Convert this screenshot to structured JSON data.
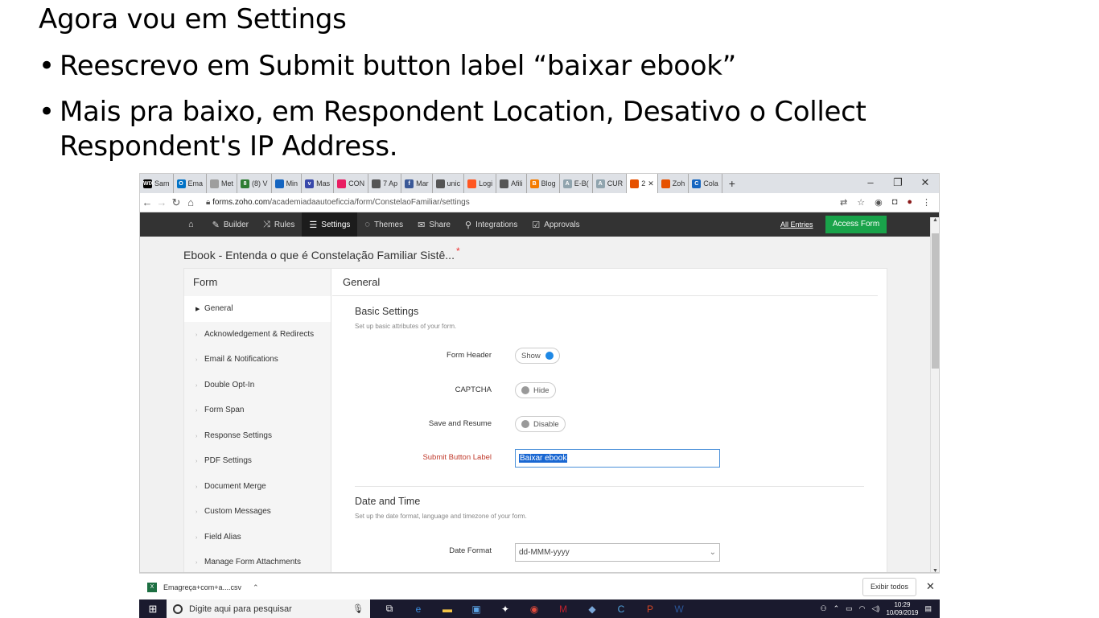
{
  "slide": {
    "title": "Agora vou em Settings",
    "bullets": [
      "Reescrevo em Submit button label “baixar ebook”",
      "Mais pra baixo, em Respondent Location, Desativo o Collect",
      "Respondent's IP Address."
    ],
    "bullet_symbol": "•"
  },
  "browser": {
    "tabs": [
      {
        "label": "Sam",
        "icon": "wix-icon",
        "color": "#000000",
        "glyph": "WIX"
      },
      {
        "label": "Ema",
        "icon": "outlook-icon",
        "color": "#0072c6",
        "glyph": "O"
      },
      {
        "label": "Met",
        "icon": "page-icon",
        "color": "#9e9e9e",
        "glyph": ""
      },
      {
        "label": "(8) V",
        "icon": "green-circle-icon",
        "color": "#2e7d32",
        "glyph": "8"
      },
      {
        "label": "Min",
        "icon": "shield-icon",
        "color": "#1565c0",
        "glyph": ""
      },
      {
        "label": "Mas",
        "icon": "mas-icon",
        "color": "#3949ab",
        "glyph": "v"
      },
      {
        "label": "CON",
        "icon": "circle-icon",
        "color": "#e91e63",
        "glyph": ""
      },
      {
        "label": "7 Ap",
        "icon": "globe-icon",
        "color": "#555555",
        "glyph": ""
      },
      {
        "label": "Mar",
        "icon": "facebook-icon",
        "color": "#3b5998",
        "glyph": "f"
      },
      {
        "label": "unic",
        "icon": "globe-icon",
        "color": "#555555",
        "glyph": ""
      },
      {
        "label": "Logi",
        "icon": "flame-icon",
        "color": "#ff5722",
        "glyph": ""
      },
      {
        "label": "Afili",
        "icon": "globe-icon",
        "color": "#555555",
        "glyph": ""
      },
      {
        "label": "Blog",
        "icon": "blogger-icon",
        "color": "#f57c00",
        "glyph": "B"
      },
      {
        "label": "E-B(",
        "icon": "doc-icon",
        "color": "#90a4ae",
        "glyph": "A"
      },
      {
        "label": "CUR",
        "icon": "doc-icon",
        "color": "#90a4ae",
        "glyph": "A"
      },
      {
        "label": "2",
        "icon": "zoho-forms-icon",
        "color": "#e65100",
        "glyph": "",
        "active": true
      },
      {
        "label": "Zoh",
        "icon": "zoho-forms-icon",
        "color": "#e65100",
        "glyph": ""
      },
      {
        "label": "Cola",
        "icon": "colab-icon",
        "color": "#1565c0",
        "glyph": "C"
      }
    ],
    "url_domain": "forms.zoho.com",
    "url_path": "/academiadaautoeficcia/form/ConstelaoFamiliar/settings"
  },
  "appbar": {
    "items": [
      {
        "label": "",
        "glyph": "⌂",
        "name": "home"
      },
      {
        "label": "Builder",
        "glyph": "✎",
        "name": "builder"
      },
      {
        "label": "Rules",
        "glyph": "⤨",
        "name": "rules"
      },
      {
        "label": "Settings",
        "glyph": "☰",
        "name": "settings",
        "active": true
      },
      {
        "label": "Themes",
        "glyph": "◌",
        "name": "themes"
      },
      {
        "label": "Share",
        "glyph": "✉",
        "name": "share"
      },
      {
        "label": "Integrations",
        "glyph": "⚲",
        "name": "integrations"
      },
      {
        "label": "Approvals",
        "glyph": "☑",
        "name": "approvals"
      }
    ],
    "all_entries": "All Entries",
    "access_form": "Access Form"
  },
  "form_title": "Ebook - Entenda o que é Constelação Familiar Sistê...",
  "left_nav": {
    "heading": "Form",
    "items": [
      "General",
      "Acknowledgement & Redirects",
      "Email & Notifications",
      "Double Opt-In",
      "Form Span",
      "Response Settings",
      "PDF Settings",
      "Document Merge",
      "Custom Messages",
      "Field Alias",
      "Manage Form Attachments"
    ]
  },
  "general": {
    "heading": "General",
    "basic_title": "Basic Settings",
    "basic_sub": "Set up basic attributes of your form.",
    "form_header_label": "Form Header",
    "form_header_value": "Show",
    "captcha_label": "CAPTCHA",
    "captcha_value": "Hide",
    "save_resume_label": "Save and Resume",
    "save_resume_value": "Disable",
    "submit_label": "Submit Button Label",
    "submit_value": "Baixar ebook",
    "date_title": "Date and Time",
    "date_sub": "Set up the date format, language and timezone of your form.",
    "date_format_label": "Date Format",
    "date_format_value": "dd-MMM-yyyy"
  },
  "download_bar": {
    "file": "Emagreça+com+a....csv",
    "show_all": "Exibir todos"
  },
  "taskbar": {
    "search_placeholder": "Digite aqui para pesquisar",
    "time": "10:29",
    "date": "10/09/2019"
  }
}
